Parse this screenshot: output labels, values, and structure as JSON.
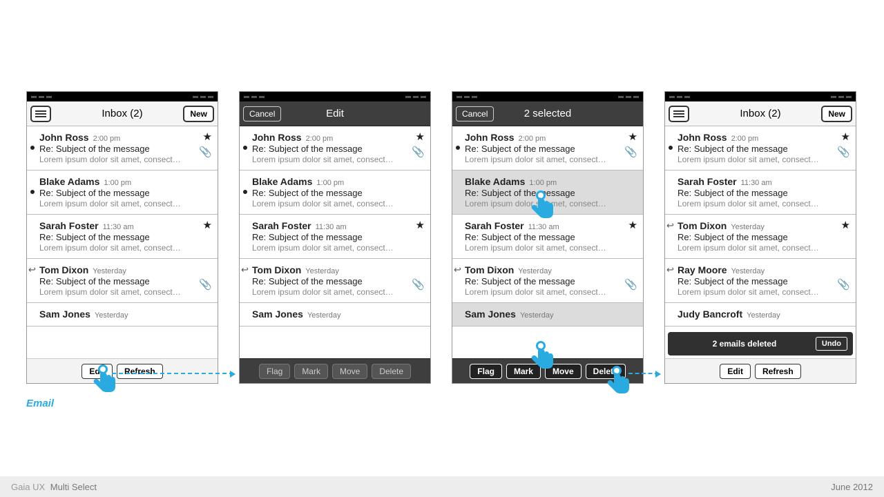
{
  "footer": {
    "brand": "Gaia UX",
    "title": "Multi Select",
    "date": "June 2012"
  },
  "label": "Email",
  "buttons": {
    "new": "New",
    "cancel": "Cancel",
    "edit": "Edit",
    "refresh": "Refresh",
    "flag": "Flag",
    "mark": "Mark",
    "move": "Move",
    "delete": "Delete",
    "undo": "Undo"
  },
  "titles": {
    "inbox": "Inbox (2)",
    "edit": "Edit",
    "selected": "2 selected"
  },
  "toast": "2 emails deleted",
  "messages_a": [
    {
      "sender": "John Ross",
      "time": "2:00 pm",
      "subj": "Re: Subject of the message",
      "prev": "Lorem ipsum dolor sit amet, consect…",
      "unread": true,
      "star": true,
      "attach": true
    },
    {
      "sender": "Blake Adams",
      "time": "1:00 pm",
      "subj": "Re: Subject of the message",
      "prev": "Lorem ipsum dolor sit amet, consect…",
      "unread": true
    },
    {
      "sender": "Sarah Foster",
      "time": "11:30 am",
      "subj": "Re: Subject of the message",
      "prev": "Lorem ipsum dolor sit amet, consect…",
      "star": true
    },
    {
      "sender": "Tom Dixon",
      "time": "Yesterday",
      "subj": "Re: Subject of the message",
      "prev": "Lorem ipsum dolor sit amet, consect…",
      "reply": true,
      "attach": true
    },
    {
      "sender": "Sam Jones",
      "time": "Yesterday",
      "subj": "",
      "prev": ""
    }
  ],
  "messages_c": [
    {
      "sender": "John Ross",
      "time": "2:00 pm",
      "subj": "Re: Subject of the message",
      "prev": "Lorem ipsum dolor sit amet, consect…",
      "unread": true,
      "star": true,
      "attach": true
    },
    {
      "sender": "Blake Adams",
      "time": "1:00 pm",
      "subj": "Re: Subject of the message",
      "prev": "Lorem ipsum dolor sit amet, consect…",
      "sel": true
    },
    {
      "sender": "Sarah Foster",
      "time": "11:30 am",
      "subj": "Re: Subject of the message",
      "prev": "Lorem ipsum dolor sit amet, consect…",
      "star": true
    },
    {
      "sender": "Tom Dixon",
      "time": "Yesterday",
      "subj": "Re: Subject of the message",
      "prev": "Lorem ipsum dolor sit amet, consect…",
      "reply": true,
      "attach": true
    },
    {
      "sender": "Sam Jones",
      "time": "Yesterday",
      "subj": "",
      "prev": "",
      "sel": true
    }
  ],
  "messages_d": [
    {
      "sender": "John Ross",
      "time": "2:00 pm",
      "subj": "Re: Subject of the message",
      "prev": "Lorem ipsum dolor sit amet, consect…",
      "unread": true,
      "star": true,
      "attach": true
    },
    {
      "sender": "Sarah Foster",
      "time": "11:30 am",
      "subj": "Re: Subject of the message",
      "prev": "Lorem ipsum dolor sit amet, consect…"
    },
    {
      "sender": "Tom Dixon",
      "time": "Yesterday",
      "subj": "Re: Subject of the message",
      "prev": "Lorem ipsum dolor sit amet, consect…",
      "reply": true,
      "star": true
    },
    {
      "sender": "Ray Moore",
      "time": "Yesterday",
      "subj": "Re: Subject of the message",
      "prev": "Lorem ipsum dolor sit amet, consect…",
      "reply": true,
      "attach": true
    },
    {
      "sender": "Judy Bancroft",
      "time": "Yesterday",
      "subj": "",
      "prev": ""
    }
  ]
}
